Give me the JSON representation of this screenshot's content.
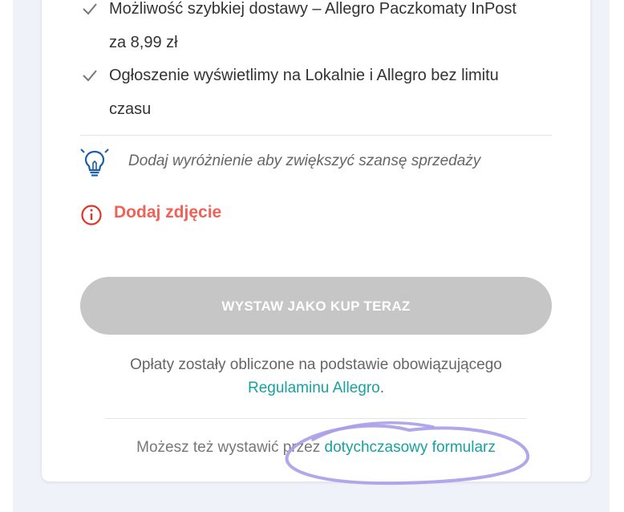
{
  "benefits": [
    {
      "line1": "Możliwość szybkiej dostawy – Allegro Paczkomaty InPost",
      "line2": "za 8,99 zł"
    },
    {
      "line1": "Ogłoszenie wyświetlimy na Lokalnie i Allegro bez limitu",
      "line2": "czasu"
    }
  ],
  "tip": {
    "text": "Dodaj wyróżnienie aby zwiększyć szansę sprzedaży",
    "icon": "lightbulb-icon"
  },
  "warning": {
    "text": "Dodaj zdjęcie",
    "icon": "info-circle-icon",
    "color": "#f06158"
  },
  "submit": {
    "label": "WYSTAW JAKO KUP TERAZ"
  },
  "fees": {
    "text": "Opłaty zostały obliczone na podstawie obowiązującego",
    "link": "Regulaminu Allegro",
    "suffix": "."
  },
  "alternative": {
    "text": "Możesz też wystawić przez",
    "link": "dotychczasowy formularz"
  },
  "colors": {
    "accent": "#17a2a0",
    "disabled": "#c6c6c6",
    "error": "#f06158",
    "icon_blue": "#1a5fa8"
  }
}
